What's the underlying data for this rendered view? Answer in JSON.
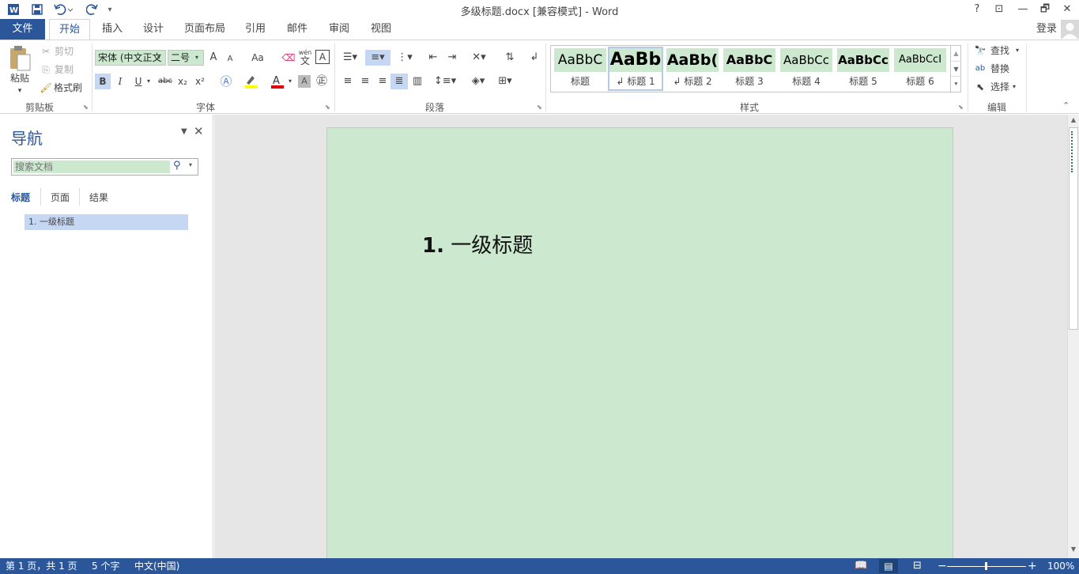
{
  "titlebar": {
    "title": "多级标题.docx [兼容模式] - Word",
    "help": "?",
    "minimize": "—",
    "restore": "🗗",
    "close": "✕",
    "ribbon_display": "⊡"
  },
  "tabs": {
    "file": "文件",
    "home": "开始",
    "insert": "插入",
    "design": "设计",
    "layout": "页面布局",
    "references": "引用",
    "mailings": "邮件",
    "review": "审阅",
    "view": "视图",
    "signin": "登录"
  },
  "clipboard": {
    "paste": "粘贴",
    "cut": "剪切",
    "copy": "复制",
    "format_painter": "格式刷",
    "label": "剪贴板"
  },
  "font": {
    "name": "宋体 (中文正文",
    "size": "二号",
    "label": "字体",
    "grow": "A",
    "shrink": "A",
    "case": "Aa",
    "bold": "B",
    "italic": "I",
    "underline": "U",
    "strike": "abc",
    "subscript": "x₂",
    "superscript": "x²",
    "phonetic": "wén",
    "phonetic_char": "文"
  },
  "paragraph": {
    "label": "段落"
  },
  "styles": {
    "label": "样式",
    "items": [
      {
        "preview": "AaBbC",
        "name": "标题"
      },
      {
        "preview": "AaBb",
        "name": "↲ 标题 1"
      },
      {
        "preview": "AaBb(",
        "name": "↲ 标题 2"
      },
      {
        "preview": "AaBbC",
        "name": "标题 3"
      },
      {
        "preview": "AaBbCc",
        "name": "标题 4"
      },
      {
        "preview": "AaBbCc",
        "name": "标题 5"
      },
      {
        "preview": "AaBbCcI",
        "name": "标题 6"
      }
    ]
  },
  "editing": {
    "find": "查找",
    "replace": "替换",
    "select": "选择",
    "label": "编辑"
  },
  "nav": {
    "title": "导航",
    "search_placeholder": "搜索文档",
    "tab_headings": "标题",
    "tab_pages": "页面",
    "tab_results": "结果",
    "heading_item": "1. 一级标题"
  },
  "document": {
    "heading_number": "1.",
    "heading_text": "一级标题"
  },
  "status": {
    "page": "第 1 页，共 1 页",
    "words": "5 个字",
    "language": "中文(中国)",
    "zoom": "100%"
  },
  "colors": {
    "accent": "#2b579a",
    "page_bg": "#cce8cf",
    "nav_selected": "#c5d7f2"
  }
}
